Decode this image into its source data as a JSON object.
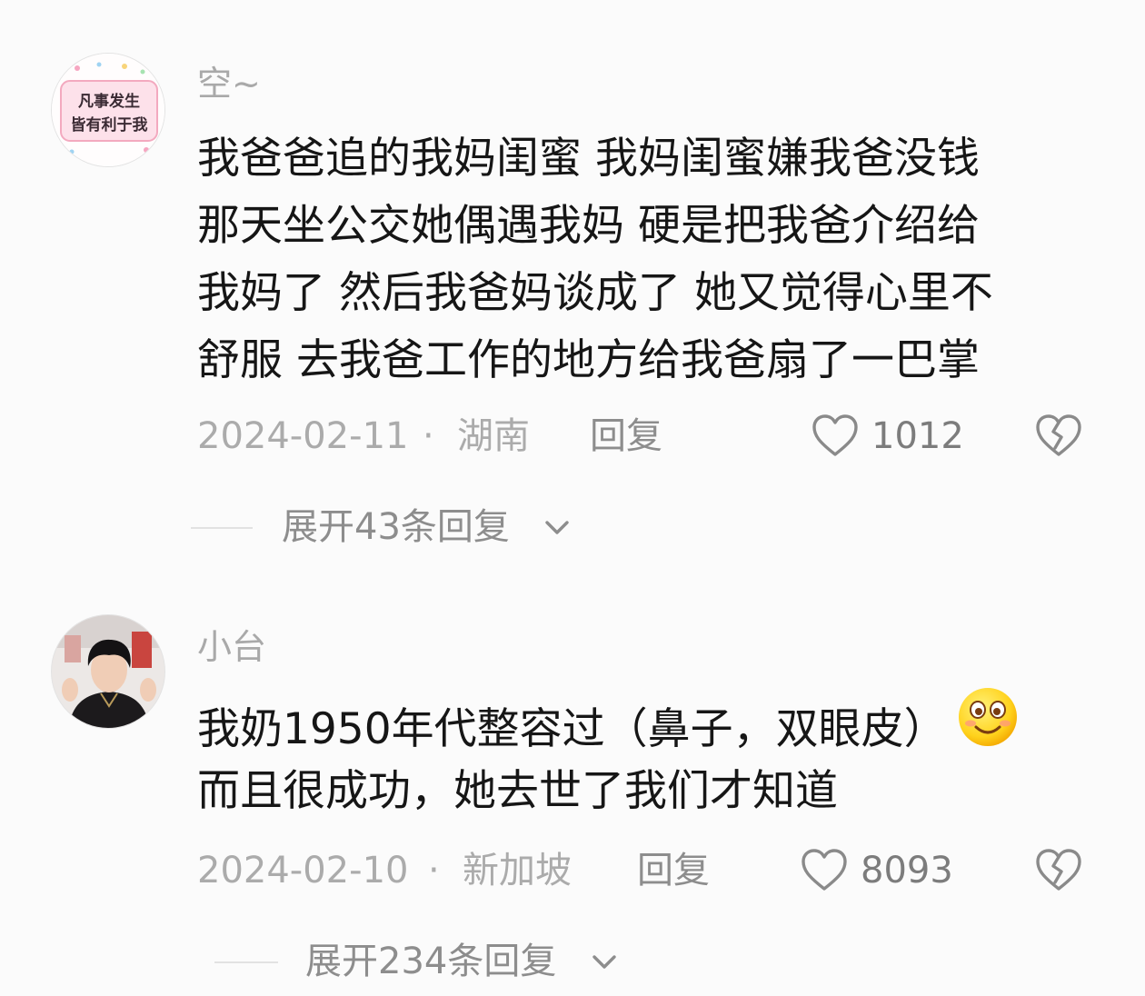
{
  "comments": [
    {
      "username": "空~",
      "avatar_text": [
        "凡事发生",
        "皆有利于我"
      ],
      "lines": [
        "我爸爸追的我妈闺蜜 我妈闺蜜嫌我爸没钱",
        "那天坐公交她偶遇我妈 硬是把我爸介绍给",
        "我妈了 然后我爸妈谈成了 她又觉得心里不",
        "舒服 去我爸工作的地方给我爸扇了一巴掌"
      ],
      "date": "2024-02-11",
      "location": "湖南",
      "reply_label": "回复",
      "likes": "1012",
      "expand_label": "展开43条回复"
    },
    {
      "username": "小台",
      "lines": [
        "我奶1950年代整容过（鼻子，双眼皮）",
        "而且很成功，她去世了我们才知道"
      ],
      "date": "2024-02-10",
      "location": "新加坡",
      "reply_label": "回复",
      "likes": "8093",
      "expand_label": "展开234条回复"
    }
  ],
  "meta_separator": "·",
  "icons": {
    "like": "heart-outline-icon",
    "dislike": "broken-heart-icon",
    "expand": "chevron-down-icon",
    "emoji": "smiley-emoji-icon"
  },
  "colors": {
    "background": "#fbfbfb",
    "text": "#161616",
    "muted": "#ababab"
  }
}
